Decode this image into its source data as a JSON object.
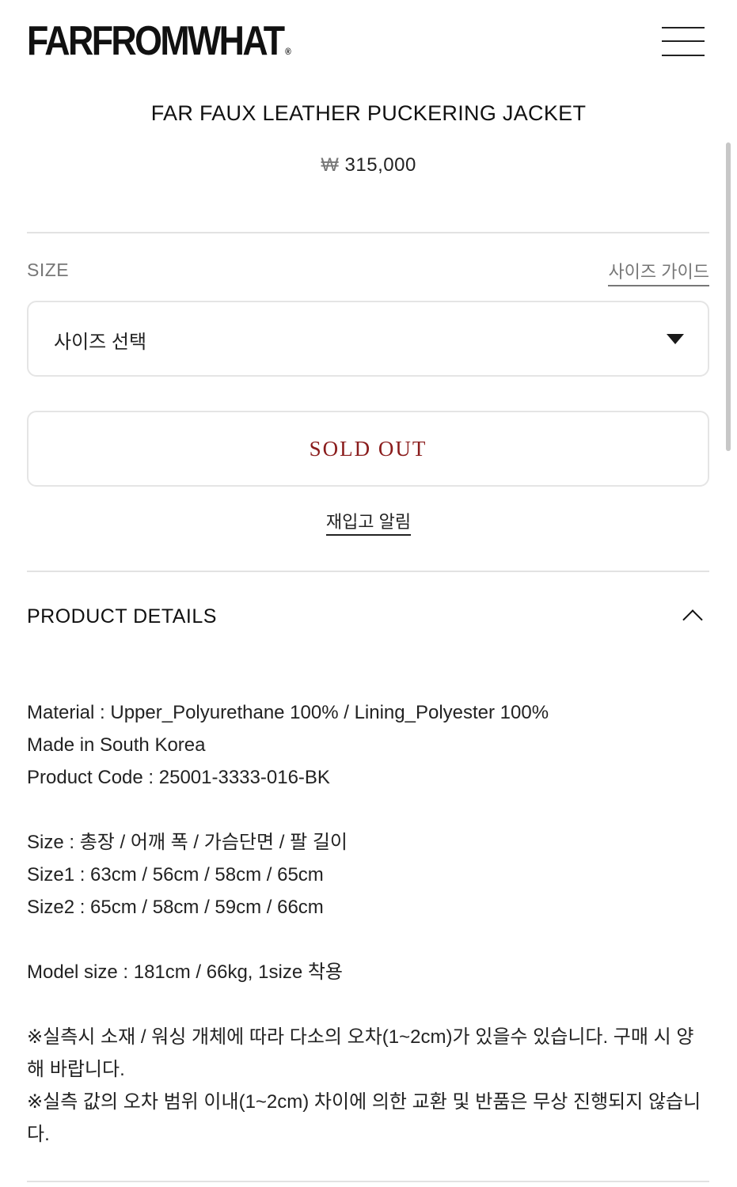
{
  "header": {
    "logo": "FARFROMWHAT",
    "logo_mark": "®",
    "menu_icon": "hamburger-menu-icon"
  },
  "product": {
    "title": "FAR FAUX LEATHER PUCKERING JACKET",
    "currency": "₩",
    "price": "315,000"
  },
  "size": {
    "label": "SIZE",
    "guide_link": "사이즈 가이드",
    "select_placeholder": "사이즈 선택",
    "select_icon": "caret-down-icon"
  },
  "actions": {
    "sold_out": "SOLD OUT",
    "restock_alert": "재입고 알림"
  },
  "details": {
    "heading": "PRODUCT DETAILS",
    "toggle_icon": "chevron-up-icon",
    "material": "Material : Upper_Polyurethane 100% / Lining_Polyester 100%",
    "made_in": "Made in South Korea",
    "product_code": "Product Code : 25001-3333-016-BK",
    "size_header": "Size : 총장 / 어깨 폭 / 가슴단면 / 팔 길이",
    "size1": "Size1 : 63cm / 56cm / 58cm / 65cm",
    "size2": "Size2 : 65cm / 58cm / 59cm / 66cm",
    "model": "Model size : 181cm / 66kg, 1size 착용",
    "note1": "※실측시 소재 / 워싱 개체에 따라 다소의 오차(1~2cm)가 있을수 있습니다. 구매 시 양해 바랍니다.",
    "note2": "※실측 값의 오차 범위 이내(1~2cm) 차이에 의한 교환 및 반품은 무상 진행되지 않습니다."
  },
  "colors": {
    "sold_out_text": "#8a1c1c",
    "muted_text": "#777777",
    "border": "#e5e5e5"
  }
}
